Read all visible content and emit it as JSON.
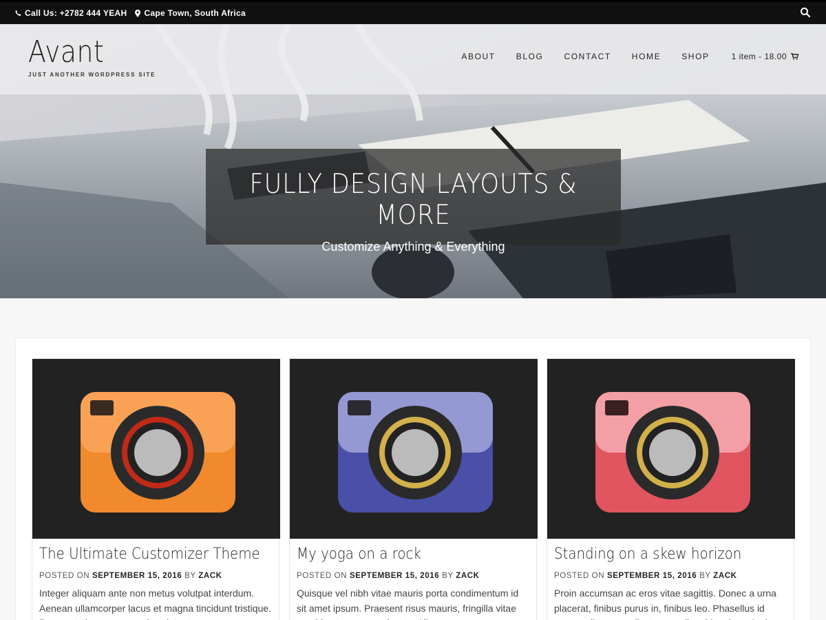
{
  "topbar": {
    "phone": "Call Us: +2782 444 YEAH",
    "location": "Cape Town, South Africa"
  },
  "site": {
    "title": "Avant",
    "tagline": "JUST ANOTHER WORDPRESS SITE"
  },
  "nav": {
    "items": [
      {
        "label": "ABOUT"
      },
      {
        "label": "BLOG"
      },
      {
        "label": "CONTACT"
      },
      {
        "label": "HOME"
      },
      {
        "label": "SHOP"
      }
    ],
    "cart": "1 item - 18.00"
  },
  "banner": {
    "title": "FULLY DESIGN LAYOUTS & MORE",
    "subtitle": "Customize Anything & Everything"
  },
  "posts": [
    {
      "title": "The Ultimate Customizer Theme",
      "posted_on": "POSTED ON",
      "date": "SEPTEMBER 15, 2016",
      "by": "BY",
      "author": "ZACK",
      "excerpt": "Integer aliquam ante non metus volutpat interdum. Aenean ullamcorper lacus et magna tincidunt tristique. Praesent viverra ac mauris volutpat",
      "camera_color": "#f08a2c"
    },
    {
      "title": "My yoga on a rock",
      "posted_on": "POSTED ON",
      "date": "SEPTEMBER 15, 2016",
      "by": "BY",
      "author": "ZACK",
      "excerpt": "Quisque vel nibh vitae mauris porta condimentum id sit amet ipsum. Praesent risus mauris, fringilla vitae gravida ut, semper a lectus. Aliquam posuere a",
      "camera_color": "#4a4fa8"
    },
    {
      "title": "Standing on a skew horizon",
      "posted_on": "POSTED ON",
      "date": "SEPTEMBER 15, 2016",
      "by": "BY",
      "author": "ZACK",
      "excerpt": "Proin accumsan ac eros vitae sagittis. Donec a urna placerat, finibus purus in, finibus leo. Phasellus id massa aliquam, pellentesque diam id, euismod mi",
      "camera_color": "#e05560"
    }
  ],
  "colors": {
    "topbar": "#111111",
    "header_overlay": "#ebebee",
    "banner_overlay": "#282828",
    "thumb_bg": "#222222"
  }
}
